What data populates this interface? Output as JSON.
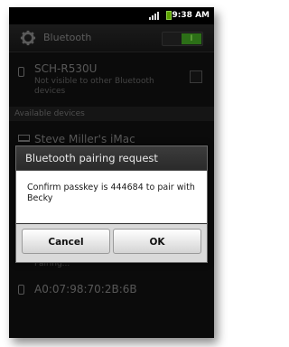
{
  "status_bar": {
    "time": "9:38 AM",
    "icons": [
      "signal-icon",
      "battery-icon"
    ]
  },
  "header": {
    "title": "Bluetooth",
    "toggle_label": "I",
    "icon": "gear-icon"
  },
  "my_device": {
    "name": "SCH-R530U",
    "subtitle": "Not visible to other Bluetooth devices",
    "icon": "phone-icon"
  },
  "section": {
    "available_label": "Available devices"
  },
  "devices": [
    {
      "name": "Steve Miller's iMac",
      "status": "",
      "icon": "laptop-icon"
    },
    {
      "name": "",
      "status": "Pairing...",
      "icon": "phone-icon"
    },
    {
      "name": "A0:07:98:70:2B:6B",
      "status": "",
      "icon": "phone-icon"
    }
  ],
  "dialog": {
    "title": "Bluetooth pairing request",
    "message": "Confirm passkey is 444684 to pair with Becky",
    "cancel_label": "Cancel",
    "ok_label": "OK"
  },
  "colors": {
    "toggle_on": "#2c6f17",
    "dialog_title_bg": "#333333",
    "battery": "#5ea400"
  }
}
